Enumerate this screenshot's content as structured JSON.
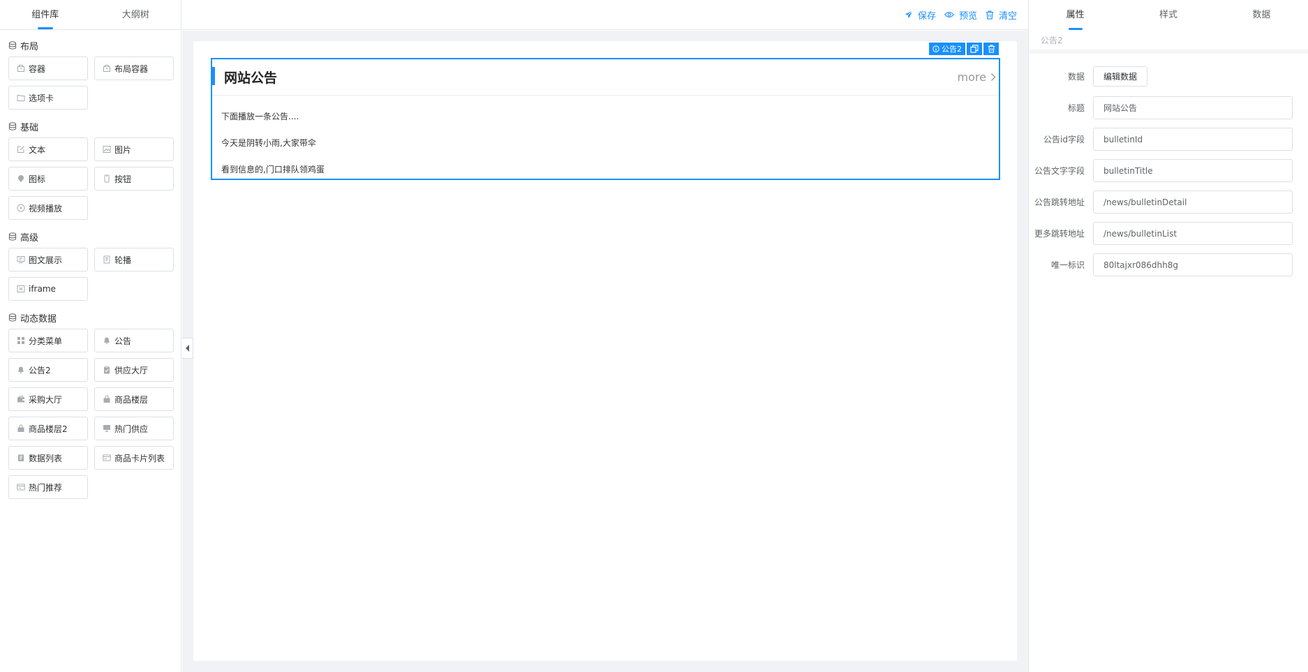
{
  "left_panel": {
    "tabs": [
      {
        "label": "组件库",
        "active": true
      },
      {
        "label": "大纲树",
        "active": false
      }
    ],
    "groups": [
      {
        "title": "布局",
        "items": [
          {
            "label": "容器",
            "icon": "box-icon"
          },
          {
            "label": "布局容器",
            "icon": "box-icon"
          },
          {
            "label": "选项卡",
            "icon": "folder-icon"
          }
        ]
      },
      {
        "title": "基础",
        "items": [
          {
            "label": "文本",
            "icon": "edit-icon"
          },
          {
            "label": "图片",
            "icon": "picture-icon"
          },
          {
            "label": "图标",
            "icon": "pin-icon"
          },
          {
            "label": "按钮",
            "icon": "phone-icon"
          },
          {
            "label": "视频播放",
            "icon": "play-icon"
          }
        ]
      },
      {
        "title": "高级",
        "items": [
          {
            "label": "图文展示",
            "icon": "image-text-icon"
          },
          {
            "label": "轮播",
            "icon": "carousel-icon"
          },
          {
            "label": "iframe",
            "icon": "frame-icon"
          }
        ]
      },
      {
        "title": "动态数据",
        "items": [
          {
            "label": "分类菜单",
            "icon": "grid-icon"
          },
          {
            "label": "公告",
            "icon": "bell-icon"
          },
          {
            "label": "公告2",
            "icon": "bell-icon"
          },
          {
            "label": "供应大厅",
            "icon": "clipboard-icon"
          },
          {
            "label": "采购大厅",
            "icon": "wallet-icon"
          },
          {
            "label": "商品楼层",
            "icon": "bag-icon"
          },
          {
            "label": "商品楼层2",
            "icon": "bag-icon"
          },
          {
            "label": "热门供应",
            "icon": "monitor-icon"
          },
          {
            "label": "数据列表",
            "icon": "list-icon"
          },
          {
            "label": "商品卡片列表",
            "icon": "card-icon"
          },
          {
            "label": "热门推荐",
            "icon": "card-icon"
          }
        ]
      }
    ]
  },
  "toolbar": {
    "save_label": "保存",
    "preview_label": "预览",
    "clear_label": "清空"
  },
  "canvas": {
    "selected_component": "公告2",
    "bulletin": {
      "title": "网站公告",
      "more": "more",
      "items": [
        "下面播放一条公告....",
        "今天是阴转小雨,大家带伞",
        "看到信息的,门口排队领鸡蛋"
      ]
    }
  },
  "right_panel": {
    "tabs": [
      {
        "label": "属性",
        "active": true
      },
      {
        "label": "样式",
        "active": false
      },
      {
        "label": "数据",
        "active": false
      }
    ],
    "component_name": "公告2",
    "data_label": "数据",
    "edit_data_button": "编辑数据",
    "fields": [
      {
        "label": "标题",
        "value": "网站公告"
      },
      {
        "label": "公告id字段",
        "value": "bulletinId"
      },
      {
        "label": "公告文字字段",
        "value": "bulletinTitle"
      },
      {
        "label": "公告跳转地址",
        "value": "/news/bulletinDetail"
      },
      {
        "label": "更多跳转地址",
        "value": "/news/bulletinList"
      },
      {
        "label": "唯一标识",
        "value": "80ltajxr086dhh8g"
      }
    ],
    "colors": {
      "accent": "#1890ff",
      "border": "#dcdfe6"
    }
  }
}
